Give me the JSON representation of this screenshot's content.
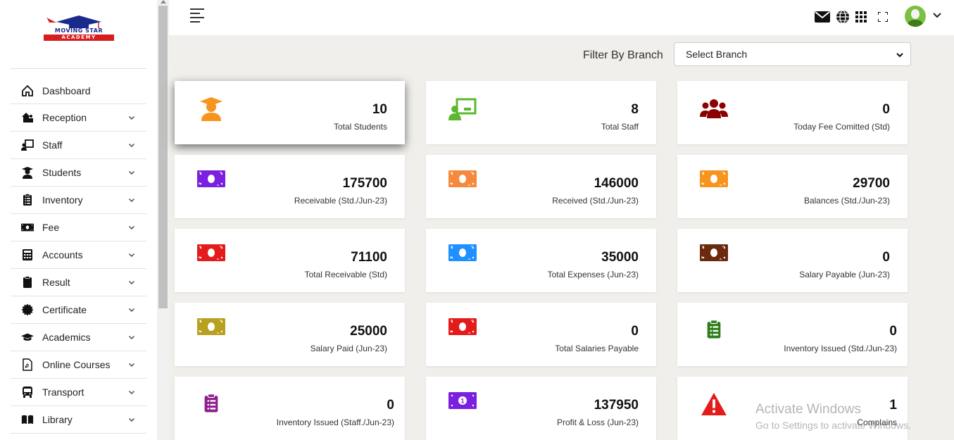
{
  "brand": {
    "name_line1": "MOVING STAR",
    "name_line2": "ACADEMY"
  },
  "sidebar": {
    "items": [
      {
        "label": "Dashboard",
        "icon": "home-icon",
        "has_submenu": false
      },
      {
        "label": "Reception",
        "icon": "reception-icon",
        "has_submenu": true
      },
      {
        "label": "Staff",
        "icon": "staff-icon",
        "has_submenu": true
      },
      {
        "label": "Students",
        "icon": "student-icon",
        "has_submenu": true
      },
      {
        "label": "Inventory",
        "icon": "clipboard-list-icon",
        "has_submenu": true
      },
      {
        "label": "Fee",
        "icon": "money-icon",
        "has_submenu": true
      },
      {
        "label": "Accounts",
        "icon": "calculator-icon",
        "has_submenu": true
      },
      {
        "label": "Result",
        "icon": "clipboard-icon",
        "has_submenu": true
      },
      {
        "label": "Certificate",
        "icon": "certificate-icon",
        "has_submenu": true
      },
      {
        "label": "Academics",
        "icon": "graduation-cap-icon",
        "has_submenu": true
      },
      {
        "label": "Online Courses",
        "icon": "pdf-file-icon",
        "has_submenu": true
      },
      {
        "label": "Transport",
        "icon": "bus-icon",
        "has_submenu": true
      },
      {
        "label": "Library",
        "icon": "book-icon",
        "has_submenu": true
      }
    ]
  },
  "topbar": {
    "icons": [
      "menu-icon",
      "mail-icon",
      "globe-icon",
      "grid-icon",
      "fullscreen-icon",
      "user-avatar",
      "chevron-down-icon"
    ]
  },
  "filter": {
    "label": "Filter By Branch",
    "selected": "Select Branch"
  },
  "cards": [
    {
      "value": "10",
      "label": "Total Students",
      "icon": "student-icon",
      "color": "#f7941d"
    },
    {
      "value": "8",
      "label": "Total Staff",
      "icon": "staff-board-icon",
      "color": "#5cb82f"
    },
    {
      "value": "0",
      "label": "Today Fee Comitted (Std)",
      "icon": "users-icon",
      "color": "#8b0000"
    },
    {
      "value": "175700",
      "label": "Receivable (Std./Jun-23)",
      "icon": "money-icon",
      "color": "#7b1fe0"
    },
    {
      "value": "146000",
      "label": "Received (Std./Jun-23)",
      "icon": "money-icon",
      "color": "#f58a3c"
    },
    {
      "value": "29700",
      "label": "Balances (Std./Jun-23)",
      "icon": "money-icon",
      "color": "#f7941d"
    },
    {
      "value": "71100",
      "label": "Total Receivable (Std)",
      "icon": "money-icon",
      "color": "#e41b1b"
    },
    {
      "value": "35000",
      "label": "Total Expenses (Jun-23)",
      "icon": "money-icon",
      "color": "#1e90ff"
    },
    {
      "value": "0",
      "label": "Salary Payable (Jun-23)",
      "icon": "money-icon",
      "color": "#6b2a0e"
    },
    {
      "value": "25000",
      "label": "Salary Paid (Jun-23)",
      "icon": "money-icon",
      "color": "#b8a020"
    },
    {
      "value": "0",
      "label": "Total Salaries Payable",
      "icon": "money-icon",
      "color": "#e41b1b"
    },
    {
      "value": "0",
      "label": "Inventory Issued (Std./Jun-23)",
      "icon": "clipboard-list-icon",
      "color": "#2e7d1a"
    },
    {
      "value": "0",
      "label": "Inventory Issued (Staff./Jun-23)",
      "icon": "clipboard-list-icon",
      "color": "#8e1e8e"
    },
    {
      "value": "137950",
      "label": "Profit & Loss (Jun-23)",
      "icon": "money-1-icon",
      "color": "#7b1fe0"
    },
    {
      "value": "1",
      "label": "Complains",
      "icon": "warning-icon",
      "color": "#e41b1b"
    }
  ],
  "watermark": {
    "line1": "Activate Windows",
    "line2": "Go to Settings to activate Windows."
  }
}
